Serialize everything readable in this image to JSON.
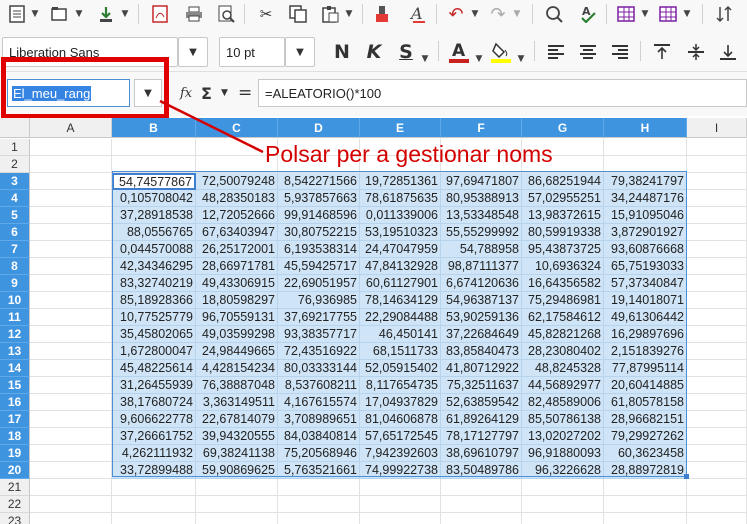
{
  "toolbar": {
    "font_name": "Liberation Sans",
    "font_size": "10 pt"
  },
  "formula_bar": {
    "name_box": "El_meu_rang",
    "function_wizard_label": "fx",
    "sum_label": "Σ",
    "equals_label": "=",
    "formula": "=ALEATORIO()*100"
  },
  "annotation": {
    "text": "Polsar per a gestionar noms"
  },
  "sheet": {
    "columns": [
      "A",
      "B",
      "C",
      "D",
      "E",
      "F",
      "G",
      "H",
      "I"
    ],
    "rows": [
      "1",
      "2",
      "3",
      "4",
      "5",
      "6",
      "7",
      "8",
      "9",
      "10",
      "11",
      "12",
      "13",
      "14",
      "15",
      "16",
      "17",
      "18",
      "19",
      "20",
      "21",
      "22",
      "23"
    ],
    "data": [
      [
        "54,74577867",
        "72,50079248",
        "8,542271566",
        "19,72851361",
        "97,69471807",
        "86,68251944",
        "79,38241797"
      ],
      [
        "0,105708042",
        "48,28350183",
        "5,937857663",
        "78,61875635",
        "80,95388913",
        "57,02955251",
        "34,24487176"
      ],
      [
        "37,28918538",
        "12,72052666",
        "99,91468596",
        "0,011339006",
        "13,53348548",
        "13,98372615",
        "15,91095046"
      ],
      [
        "88,0556765",
        "67,63403947",
        "30,80752215",
        "53,19510323",
        "55,55299992",
        "80,59919338",
        "3,872901927"
      ],
      [
        "0,044570088",
        "26,25172001",
        "6,193538314",
        "24,47047959",
        "54,788958",
        "95,43873725",
        "93,60876668"
      ],
      [
        "42,34346295",
        "28,66971781",
        "45,59425717",
        "47,84132928",
        "98,87111377",
        "10,6936324",
        "65,75193033"
      ],
      [
        "83,32740219",
        "49,43306915",
        "22,69051957",
        "60,61127901",
        "6,674120636",
        "16,64356582",
        "57,37340847"
      ],
      [
        "85,18928366",
        "18,80598297",
        "76,936985",
        "78,14634129",
        "54,96387137",
        "75,29486981",
        "19,14018071"
      ],
      [
        "10,77525779",
        "96,70559131",
        "37,69217755",
        "22,29084488",
        "53,90259136",
        "62,17584612",
        "49,61306442"
      ],
      [
        "35,45802065",
        "49,03599298",
        "93,38357717",
        "46,450141",
        "37,22684649",
        "45,82821268",
        "16,29897696"
      ],
      [
        "1,672800047",
        "24,98449665",
        "72,43516922",
        "68,1511733",
        "83,85840473",
        "28,23080402",
        "2,151839276"
      ],
      [
        "45,48225614",
        "4,428154234",
        "80,03333144",
        "52,05915402",
        "41,80712922",
        "48,8245328",
        "77,87995114"
      ],
      [
        "31,26455939",
        "76,38887048",
        "8,537608211",
        "8,117654735",
        "75,32511637",
        "44,56892977",
        "20,60414885"
      ],
      [
        "38,17680724",
        "3,363149511",
        "4,167615574",
        "17,04937829",
        "52,63859542",
        "82,48589006",
        "61,80578158"
      ],
      [
        "9,606622778",
        "22,67814079",
        "3,708989651",
        "81,04606878",
        "61,89264129",
        "85,50786138",
        "28,96682151"
      ],
      [
        "37,26661752",
        "39,94320555",
        "84,03840814",
        "57,65172545",
        "78,17127797",
        "13,02027202",
        "79,29927262"
      ],
      [
        "4,262111932",
        "69,38241138",
        "75,20568946",
        "7,942392603",
        "38,69610797",
        "96,91880093",
        "60,3623458"
      ],
      [
        "33,72899488",
        "59,90869625",
        "5,763521661",
        "74,99922738",
        "83,50489786",
        "96,3226628",
        "28,88972819"
      ]
    ]
  }
}
